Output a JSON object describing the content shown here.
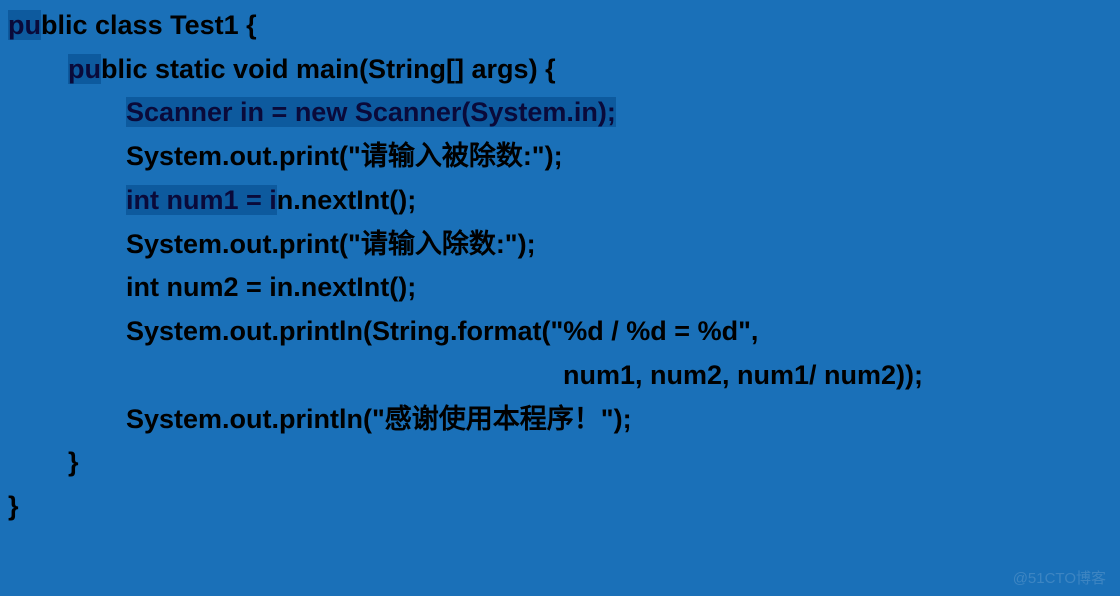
{
  "code": {
    "lines": [
      {
        "indent": 0,
        "segments": [
          {
            "text": "pu",
            "highlight": true
          },
          {
            "text": "blic class Test1 {",
            "highlight": false
          }
        ]
      },
      {
        "indent": 1,
        "segments": [
          {
            "text": "pu",
            "highlight": true
          },
          {
            "text": "blic static void main(String[] args) {",
            "highlight": false
          }
        ]
      },
      {
        "indent": 2,
        "segments": [
          {
            "text": "Scanner in = new Scanner(System.in);",
            "highlight": true
          }
        ]
      },
      {
        "indent": 2,
        "segments": [
          {
            "text": "System.out.print(\"请输入被除数:\");",
            "highlight": false
          }
        ]
      },
      {
        "indent": 2,
        "segments": [
          {
            "text": "int num1 = i",
            "highlight": true
          },
          {
            "text": "n.nextInt();",
            "highlight": false
          }
        ]
      },
      {
        "indent": 2,
        "segments": [
          {
            "text": "System.out.print(\"请输入除数:\");",
            "highlight": false
          }
        ]
      },
      {
        "indent": 2,
        "segments": [
          {
            "text": "int num2 = in.nextInt();",
            "highlight": false
          }
        ]
      },
      {
        "indent": 2,
        "segments": [
          {
            "text": "System.out.println(String.format(\"%d / %d = %d\",",
            "highlight": false
          }
        ]
      },
      {
        "indent": -1,
        "segments": [
          {
            "text": "num1, num2, num1/ num2));",
            "highlight": false
          }
        ]
      },
      {
        "indent": 2,
        "segments": [
          {
            "text": "System.out.println(\"感谢使用本程序！\");",
            "highlight": false
          }
        ]
      },
      {
        "indent": 1,
        "segments": [
          {
            "text": "}",
            "highlight": false
          }
        ]
      },
      {
        "indent": 0,
        "segments": [
          {
            "text": "}",
            "highlight": false
          }
        ]
      }
    ]
  },
  "watermark": "@51CTO博客"
}
